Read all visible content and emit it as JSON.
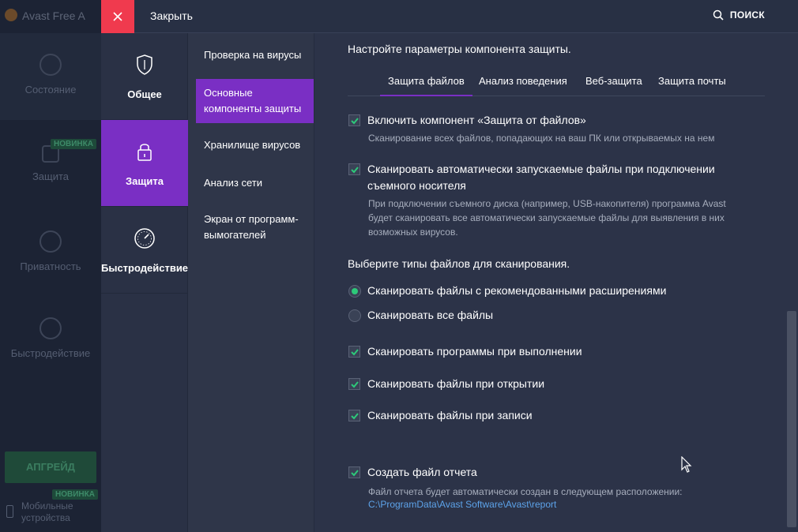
{
  "background_app": {
    "title": "Avast Free A",
    "sidebar": [
      {
        "label": "Состояние"
      },
      {
        "label": "Защита",
        "badge": "НОВИНКА"
      },
      {
        "label": "Приватность"
      },
      {
        "label": "Быстродействие"
      }
    ],
    "upgrade_label": "АПГРЕЙД",
    "mobile_badge": "НОВИНКА",
    "mobile_line1": "Мобильные",
    "mobile_line2": "устройства"
  },
  "topbar": {
    "close_label": "Закрыть",
    "search_label": "ПОИСК"
  },
  "categories": [
    {
      "label": "Общее",
      "icon": "shield-icon",
      "active": false
    },
    {
      "label": "Защита",
      "icon": "lock-icon",
      "active": true
    },
    {
      "label": "Быстродействие",
      "icon": "speedometer-icon",
      "active": false
    }
  ],
  "subnav": [
    {
      "label_line1": "Проверка на вирусы",
      "label_line2": ""
    },
    {
      "label_line1": "Основные",
      "label_line2": "компоненты защиты",
      "active": true
    },
    {
      "label_line1": "Хранилище вирусов",
      "label_line2": ""
    },
    {
      "label_line1": "Анализ сети",
      "label_line2": ""
    },
    {
      "label_line1": "Экран от программ-",
      "label_line2": "вымогателей"
    }
  ],
  "main": {
    "heading": "Настройте параметры компонента защиты.",
    "tabs": [
      {
        "label": "Защита файлов",
        "active": true
      },
      {
        "label": "Анализ поведения"
      },
      {
        "label": "Веб-защита"
      },
      {
        "label": "Защита почты"
      }
    ],
    "enable_component": {
      "label": "Включить компонент «Защита от файлов»",
      "desc": "Сканирование всех файлов, попадающих на ваш ПК или открываемых на нем",
      "checked": true
    },
    "autorun_scan": {
      "label_line1": "Сканировать автоматически запускаемые файлы при подключении",
      "label_line2": "съемного носителя",
      "desc_line1": "При подключении съемного диска (например, USB-накопителя) программа Avast",
      "desc_line2": "будет сканировать все автоматически запускаемые файлы для выявления в них",
      "desc_line3": "возможных вирусов.",
      "checked": true
    },
    "file_types_title": "Выберите типы файлов для сканирования.",
    "radio_recommended": {
      "label": "Сканировать файлы с рекомендованными расширениями",
      "selected": true
    },
    "radio_all": {
      "label": "Сканировать все файлы",
      "selected": false
    },
    "scan_on_execute": {
      "label": "Сканировать программы при выполнении",
      "checked": true
    },
    "scan_on_open": {
      "label": "Сканировать файлы при открытии",
      "checked": true
    },
    "scan_on_write": {
      "label": "Сканировать файлы при записи",
      "checked": true
    },
    "create_report": {
      "label": "Создать файл отчета",
      "desc": "Файл отчета будет автоматически создан в следующем расположении:",
      "path": "C:\\ProgramData\\Avast Software\\Avast\\report",
      "checked": true
    }
  },
  "colors": {
    "accent_purple": "#7a2fc4",
    "close_red": "#f03a4e",
    "check_green": "#2dc97a",
    "link_blue": "#5da3ea"
  }
}
